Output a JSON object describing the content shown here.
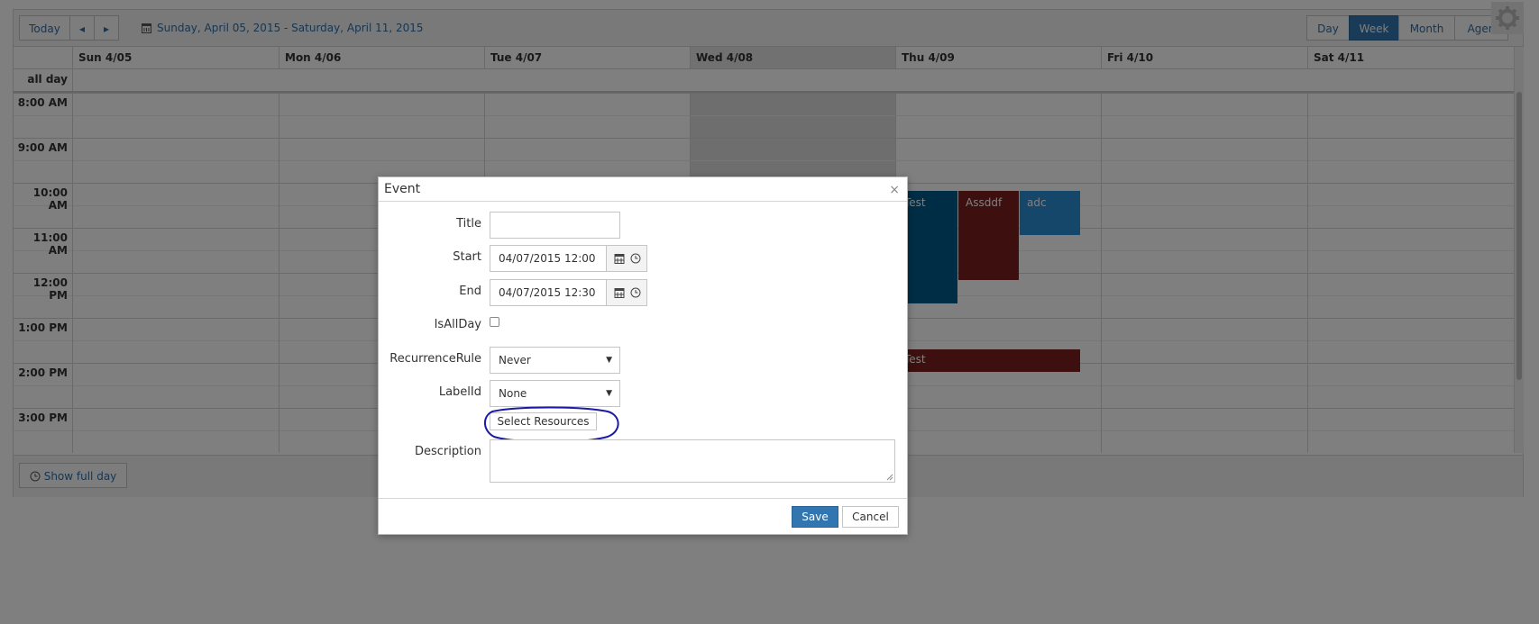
{
  "toolbar": {
    "today_label": "Today",
    "prev_label": "◂",
    "next_label": "▸",
    "date_range": "Sunday, April 05, 2015 - Saturday, April 11, 2015",
    "views": [
      "Day",
      "Week",
      "Month",
      "Agen"
    ],
    "selected_view": "Week"
  },
  "calendar": {
    "days": [
      "Sun 4/05",
      "Mon 4/06",
      "Tue 4/07",
      "Wed 4/08",
      "Thu 4/09",
      "Fri 4/10",
      "Sat 4/11"
    ],
    "all_day_label": "all day",
    "times": [
      "8:00 AM",
      "9:00 AM",
      "10:00 AM",
      "11:00 AM",
      "12:00 PM",
      "1:00 PM",
      "2:00 PM",
      "3:00 PM"
    ],
    "events": [
      {
        "title": "Test",
        "day": "Thu 4/09",
        "start": "10:00 AM",
        "end": "12:30 PM",
        "color": "#005a8c"
      },
      {
        "title": "Assddf",
        "day": "Thu 4/09",
        "start": "10:00 AM",
        "end": "12:00 PM",
        "color": "#7a1f1f"
      },
      {
        "title": "adc",
        "day": "Thu 4/09",
        "start": "10:00 AM",
        "end": "11:00 AM",
        "color": "#2b8ed6"
      },
      {
        "title": "Test",
        "day": "Thu 4/09",
        "start": "1:30 PM",
        "end": "2:00 PM",
        "color": "#7a1f1f"
      }
    ],
    "show_full_day_label": "Show full day"
  },
  "dialog": {
    "title": "Event",
    "close_glyph": "×",
    "fields": {
      "title_label": "Title",
      "title_value": "",
      "start_label": "Start",
      "start_value": "04/07/2015 12:00",
      "end_label": "End",
      "end_value": "04/07/2015 12:30",
      "isallday_label": "IsAllDay",
      "recurrence_label": "RecurrenceRule",
      "recurrence_value": "Never",
      "labelid_label": "LabelId",
      "labelid_value": "None",
      "select_resources_label": "Select Resources",
      "description_label": "Description",
      "description_value": ""
    },
    "save_label": "Save",
    "cancel_label": "Cancel"
  },
  "colors": {
    "accent": "#3276b1",
    "annotation": "#1a1aa6"
  }
}
